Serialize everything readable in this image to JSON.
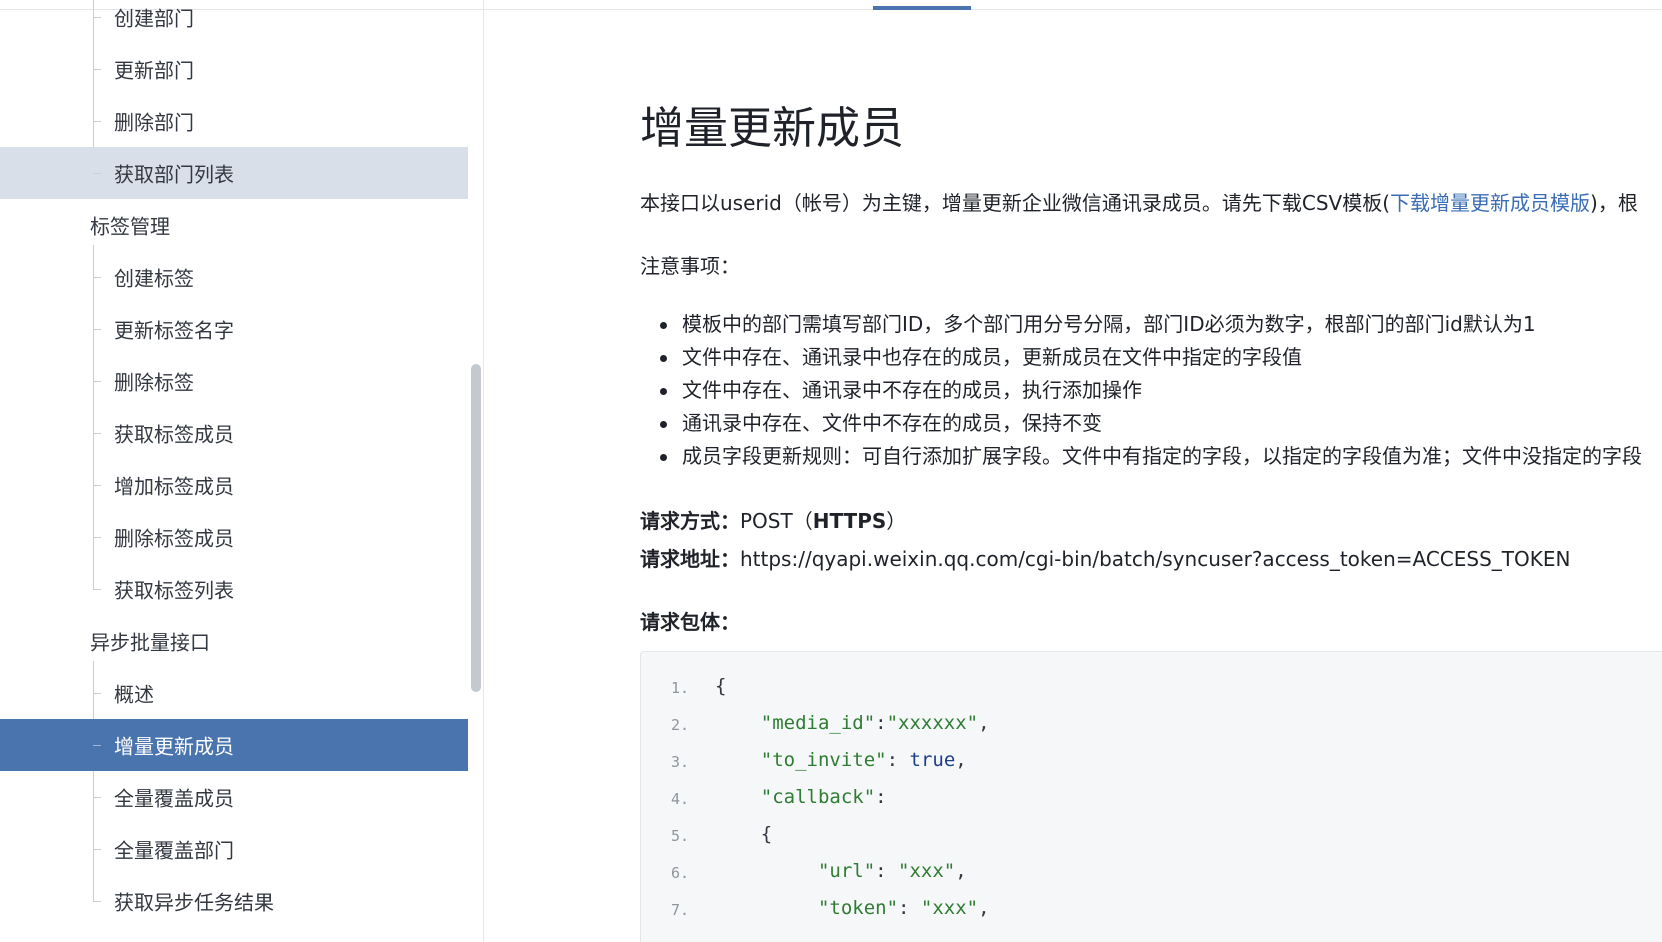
{
  "sidebar": {
    "items": [
      {
        "label": "创建部门",
        "type": "sub",
        "state": ""
      },
      {
        "label": "更新部门",
        "type": "sub",
        "state": ""
      },
      {
        "label": "删除部门",
        "type": "sub",
        "state": ""
      },
      {
        "label": "获取部门列表",
        "type": "sub",
        "state": "hover"
      },
      {
        "label": "标签管理",
        "type": "group",
        "state": ""
      },
      {
        "label": "创建标签",
        "type": "sub",
        "state": ""
      },
      {
        "label": "更新标签名字",
        "type": "sub",
        "state": ""
      },
      {
        "label": "删除标签",
        "type": "sub",
        "state": ""
      },
      {
        "label": "获取标签成员",
        "type": "sub",
        "state": ""
      },
      {
        "label": "增加标签成员",
        "type": "sub",
        "state": ""
      },
      {
        "label": "删除标签成员",
        "type": "sub",
        "state": ""
      },
      {
        "label": "获取标签列表",
        "type": "sub",
        "state": ""
      },
      {
        "label": "异步批量接口",
        "type": "group",
        "state": ""
      },
      {
        "label": "概述",
        "type": "sub",
        "state": ""
      },
      {
        "label": "增量更新成员",
        "type": "sub",
        "state": "active"
      },
      {
        "label": "全量覆盖成员",
        "type": "sub",
        "state": ""
      },
      {
        "label": "全量覆盖部门",
        "type": "sub",
        "state": ""
      },
      {
        "label": "获取异步任务结果",
        "type": "sub",
        "state": ""
      }
    ]
  },
  "content": {
    "title": "增量更新成员",
    "intro_text": "本接口以userid（帐号）为主键，增量更新企业微信通讯录成员。请先下载CSV模板(",
    "intro_link": "下载增量更新成员模版",
    "intro_suffix": ")，根",
    "notes_title": "注意事项：",
    "notes": [
      "模板中的部门需填写部门ID，多个部门用分号分隔，部门ID必须为数字，根部门的部门id默认为1",
      "文件中存在、通讯录中也存在的成员，更新成员在文件中指定的字段值",
      "文件中存在、通讯录中不存在的成员，执行添加操作",
      "通讯录中存在、文件中不存在的成员，保持不变",
      "成员字段更新规则：可自行添加扩展字段。文件中有指定的字段，以指定的字段值为准；文件中没指定的字段"
    ],
    "method_label": "请求方式：",
    "method_value": "POST（",
    "method_protocol": "HTTPS",
    "method_close": "）",
    "url_label": "请求地址：",
    "url_value": "https://qyapi.weixin.qq.com/cgi-bin/batch/syncuser?access_token=ACCESS_TOKEN",
    "body_label": "请求包体：",
    "code_lines": [
      {
        "num": "1.",
        "parts": [
          [
            "punc",
            "{"
          ]
        ]
      },
      {
        "num": "2.",
        "parts": [
          [
            "punc",
            "    "
          ],
          [
            "key",
            "\"media_id\""
          ],
          [
            "punc",
            ":"
          ],
          [
            "str",
            "\"xxxxxx\""
          ],
          [
            "punc",
            ","
          ]
        ]
      },
      {
        "num": "3.",
        "parts": [
          [
            "punc",
            "    "
          ],
          [
            "key",
            "\"to_invite\""
          ],
          [
            "punc",
            ": "
          ],
          [
            "bool",
            "true"
          ],
          [
            "punc",
            ","
          ]
        ]
      },
      {
        "num": "4.",
        "parts": [
          [
            "punc",
            "    "
          ],
          [
            "key",
            "\"callback\""
          ],
          [
            "punc",
            ":"
          ]
        ]
      },
      {
        "num": "5.",
        "parts": [
          [
            "punc",
            "    {"
          ]
        ]
      },
      {
        "num": "6.",
        "parts": [
          [
            "punc",
            "         "
          ],
          [
            "key",
            "\"url\""
          ],
          [
            "punc",
            ": "
          ],
          [
            "str",
            "\"xxx\""
          ],
          [
            "punc",
            ","
          ]
        ]
      },
      {
        "num": "7.",
        "parts": [
          [
            "punc",
            "         "
          ],
          [
            "key",
            "\"token\""
          ],
          [
            "punc",
            ": "
          ],
          [
            "str",
            "\"xxx\""
          ],
          [
            "punc",
            ","
          ]
        ]
      }
    ]
  }
}
